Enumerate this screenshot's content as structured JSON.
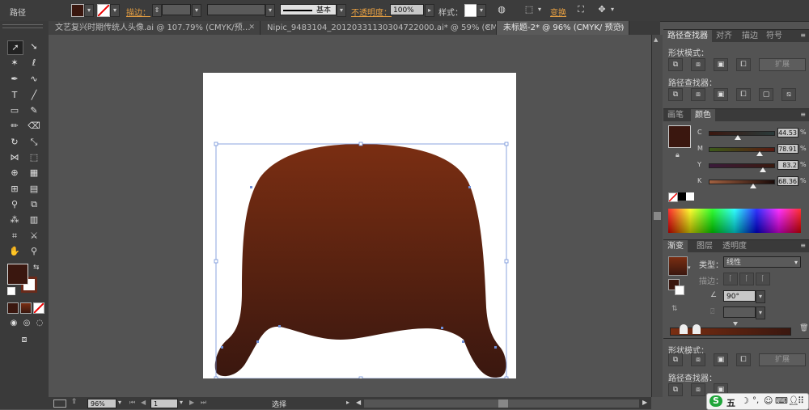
{
  "control_bar": {
    "selection_label": "路径",
    "fill_color": "#3a170f",
    "stroke_label": "描边：",
    "stroke_profile": "基本",
    "opacity_label": "不透明度：",
    "opacity_value": "100%",
    "style_label": "样式：",
    "transform_label": "变换"
  },
  "tabs": [
    {
      "label": "文艺复兴时期传统人头像.ai @ 107.79% (CMYK/预…",
      "active": false
    },
    {
      "label": "Nipic_9483104_20120331130304722000.ai* @ 59% (CMYK/…",
      "active": false
    },
    {
      "label": "未标题-2* @ 96% (CMYK/ 预览)",
      "active": true
    }
  ],
  "tools": {
    "fill_color": "#3a170f",
    "stroke_color": "#6a2a1a",
    "icons": [
      "selection-icon",
      "direct-selection-icon",
      "magic-wand-icon",
      "lasso-icon",
      "pen-icon",
      "curvature-icon",
      "type-icon",
      "line-icon",
      "rectangle-icon",
      "paintbrush-icon",
      "pencil-icon",
      "eraser-icon",
      "rotate-icon",
      "scale-icon",
      "width-icon",
      "free-transform-icon",
      "shape-builder-icon",
      "perspective-icon",
      "mesh-icon",
      "gradient-icon",
      "eyedropper-icon",
      "blend-icon",
      "symbol-sprayer-icon",
      "column-graph-icon",
      "artboard-icon",
      "slice-icon",
      "hand-icon",
      "zoom-icon"
    ]
  },
  "pathfinder_panel": {
    "tabs": [
      "路径查找器",
      "对齐",
      "描边",
      "符号"
    ],
    "shape_modes_label": "形状模式：",
    "expand_label": "扩展",
    "pathfinders_label": "路径查找器："
  },
  "color_panel": {
    "tabs": [
      "画笔",
      "颜色"
    ],
    "channels": [
      {
        "name": "C",
        "value": "44.53",
        "unit": "%",
        "level": 0.4453
      },
      {
        "name": "M",
        "value": "78.91",
        "unit": "%",
        "level": 0.7891
      },
      {
        "name": "Y",
        "value": "83.2",
        "unit": "%",
        "level": 0.832
      },
      {
        "name": "K",
        "value": "68.36",
        "unit": "%",
        "level": 0.6836
      }
    ],
    "swatch_color": "#3a170f"
  },
  "gradient_panel": {
    "tabs": [
      "渐变",
      "图层",
      "透明度"
    ],
    "type_label": "类型：",
    "type_value": "线性",
    "stroke_label": "描边：",
    "angle_value": "90°",
    "start_color": "#7a2e12",
    "end_color": "#3a170f"
  },
  "pathfinder_panel_2": {
    "shape_modes_label": "形状模式：",
    "expand_label": "扩展",
    "pathfinders_label": "路径查找器："
  },
  "status_bar": {
    "zoom_value": "96%",
    "page_value": "1",
    "status_text": "选择"
  },
  "ime": {
    "logo": "S",
    "mode_label": "五"
  }
}
